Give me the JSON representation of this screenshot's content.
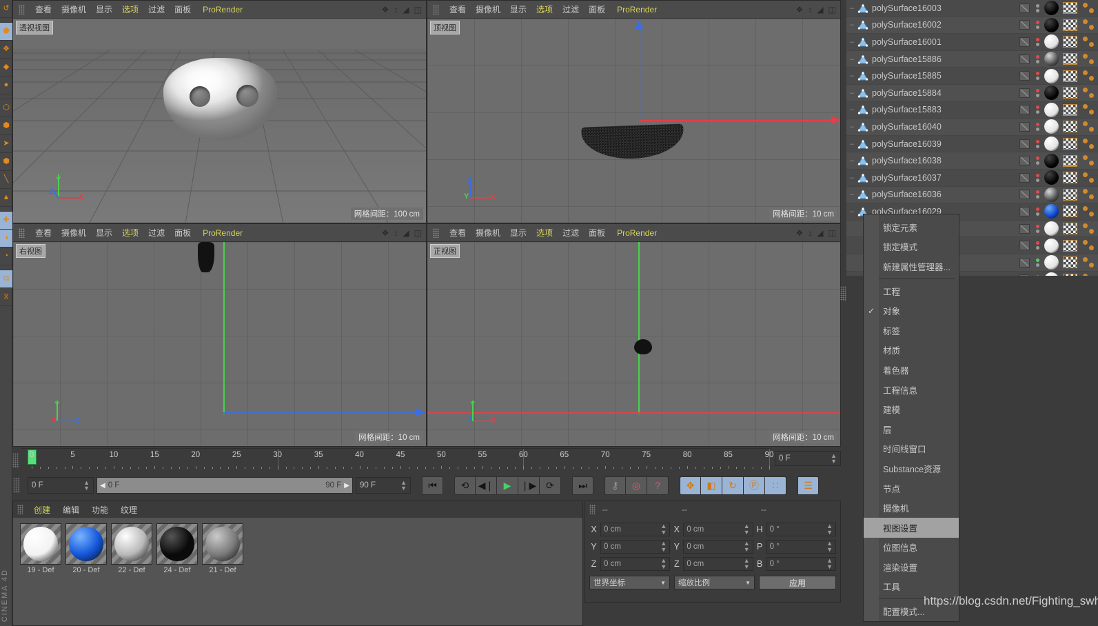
{
  "app": {
    "name": "CINEMA 4D",
    "watermark": "https://blog.csdn.net/Fighting_swh"
  },
  "left_toolbar": {
    "items": [
      {
        "name": "undo-redo-icon",
        "glyph": "↺",
        "selected": false
      },
      {
        "name": "live-selection-icon",
        "glyph": "⬟",
        "selected": true
      },
      {
        "name": "move-tool-icon",
        "glyph": "❖",
        "selected": false
      },
      {
        "name": "scale-tool-icon",
        "glyph": "◆",
        "selected": false
      },
      {
        "name": "rotate-tool-icon",
        "glyph": "●",
        "selected": false
      },
      {
        "name": "object-mode-icon",
        "glyph": "⬡",
        "selected": false
      },
      {
        "name": "model-mode-icon",
        "glyph": "⬢",
        "selected": false
      },
      {
        "name": "texture-mode-icon",
        "glyph": "➤",
        "selected": false
      },
      {
        "name": "point-mode-icon",
        "glyph": "⬢",
        "selected": false
      },
      {
        "name": "edge-mode-icon",
        "glyph": "╲",
        "selected": false
      },
      {
        "name": "polygon-mode-icon",
        "glyph": "▲",
        "selected": false
      },
      {
        "name": "axis-mode-icon",
        "glyph": "✚",
        "selected": true
      },
      {
        "name": "viewport-solo-icon",
        "glyph": "◑",
        "selected": true
      },
      {
        "name": "workplane-icon",
        "glyph": "◔",
        "selected": false
      },
      {
        "name": "snap-icon",
        "glyph": "⧉",
        "selected": true
      },
      {
        "name": "quantize-icon",
        "glyph": "⧖",
        "selected": false
      }
    ]
  },
  "viewports": [
    {
      "name": "perspective",
      "label": "透视视图",
      "grid_note": "网格间距：100 cm",
      "menu": [
        "查看",
        "摄像机",
        "显示",
        "选项",
        "过滤",
        "面板",
        "ProRender"
      ],
      "menu_highlight": [
        "选项",
        "ProRender"
      ],
      "axis_labels": [
        "Y",
        "Z",
        "X"
      ]
    },
    {
      "name": "top",
      "label": "顶视图",
      "grid_note": "网格间距：10 cm",
      "menu": [
        "查看",
        "摄像机",
        "显示",
        "选项",
        "过滤",
        "面板",
        "ProRender"
      ],
      "menu_highlight": [
        "选项",
        "ProRender"
      ],
      "axis_labels": [
        "Z",
        "Y",
        "X"
      ]
    },
    {
      "name": "right",
      "label": "右视图",
      "grid_note": "网格间距：10 cm",
      "menu": [
        "查看",
        "摄像机",
        "显示",
        "选项",
        "过滤",
        "面板",
        "ProRender"
      ],
      "menu_highlight": [
        "选项",
        "ProRender"
      ],
      "axis_labels": [
        "Y",
        "X",
        "Z"
      ]
    },
    {
      "name": "front",
      "label": "正视图",
      "grid_note": "网格间距：10 cm",
      "menu": [
        "查看",
        "摄像机",
        "显示",
        "选项",
        "过滤",
        "面板",
        "ProRender"
      ],
      "menu_highlight": [
        "选项",
        "ProRender"
      ],
      "axis_labels": [
        "Y",
        "Z",
        "X"
      ]
    }
  ],
  "timeline": {
    "ticks": [
      0,
      5,
      10,
      15,
      20,
      25,
      30,
      35,
      40,
      45,
      50,
      55,
      60,
      65,
      70,
      75,
      80,
      85,
      90
    ],
    "current_frame": "0 F",
    "playhead_frame": 0,
    "range_start": "0 F",
    "range_end": "90 F",
    "end_field": "90 F",
    "left_field": "0 F"
  },
  "transport": {
    "buttons": [
      {
        "name": "goto-start-button",
        "glyph": "⏮"
      },
      {
        "name": "previous-key-button",
        "glyph": "⟲"
      },
      {
        "name": "step-back-button",
        "glyph": "◀❘"
      },
      {
        "name": "play-button",
        "glyph": "▶"
      },
      {
        "name": "step-forward-button",
        "glyph": "❘▶"
      },
      {
        "name": "next-key-button",
        "glyph": "⟳"
      },
      {
        "name": "goto-end-button",
        "glyph": "⏭"
      },
      {
        "name": "record-settings-button",
        "glyph": "⚷"
      },
      {
        "name": "autokey-button",
        "glyph": "◎"
      },
      {
        "name": "keyframe-help-button",
        "glyph": "?"
      },
      {
        "name": "position-key-button",
        "glyph": "✥"
      },
      {
        "name": "scale-key-button",
        "glyph": "◧"
      },
      {
        "name": "rotation-key-button",
        "glyph": "↻"
      },
      {
        "name": "pla-key-button",
        "glyph": "Ⓟ"
      },
      {
        "name": "point-level-animation-button",
        "glyph": "∷"
      },
      {
        "name": "keyframe-mode-button",
        "glyph": "☰"
      }
    ]
  },
  "material_manager": {
    "menu": [
      "创建",
      "编辑",
      "功能",
      "纹理"
    ],
    "menu_highlight": [
      "创建"
    ],
    "materials": [
      {
        "name": "19 - Def",
        "color": "#f2f2f2",
        "highlight": "#ffffff"
      },
      {
        "name": "20 - Def",
        "color": "#1255d8",
        "highlight": "#79b4ff"
      },
      {
        "name": "22 - Def",
        "color": "#b8b8b8",
        "highlight": "#ffffff"
      },
      {
        "name": "24 - Def",
        "color": "#0a0a0a",
        "highlight": "#555555"
      },
      {
        "name": "21 - Def",
        "color": "#7a7a7a",
        "highlight": "#cacaca"
      }
    ]
  },
  "coordinate_manager": {
    "header": [
      "--",
      "--",
      "--"
    ],
    "rows": [
      {
        "pos_label": "X",
        "pos_value": "0 cm",
        "size_label": "X",
        "size_value": "0 cm",
        "rot_label": "H",
        "rot_value": "0 °"
      },
      {
        "pos_label": "Y",
        "pos_value": "0 cm",
        "size_label": "Y",
        "size_value": "0 cm",
        "rot_label": "P",
        "rot_value": "0 °"
      },
      {
        "pos_label": "Z",
        "pos_value": "0 cm",
        "size_label": "Z",
        "size_value": "0 cm",
        "rot_label": "B",
        "rot_value": "0 °"
      }
    ],
    "coord_system": "世界坐标",
    "scale_mode": "缩放比例",
    "apply_label": "应用"
  },
  "object_manager": {
    "objects": [
      {
        "name": "polySurface16003",
        "dot_top": "#9a9a9a",
        "dot_bottom": "#9a9a9a",
        "mat": "black",
        "partial": true
      },
      {
        "name": "polySurface16002",
        "dot_top": "#e04b4b",
        "dot_bottom": "#9a9a9a",
        "mat": "black"
      },
      {
        "name": "polySurface16001",
        "dot_top": "#e04b4b",
        "dot_bottom": "#9a9a9a",
        "mat": "white"
      },
      {
        "name": "polySurface15886",
        "dot_top": "#e04b4b",
        "dot_bottom": "#9a9a9a",
        "mat": "grey"
      },
      {
        "name": "polySurface15885",
        "dot_top": "#e04b4b",
        "dot_bottom": "#9a9a9a",
        "mat": "white"
      },
      {
        "name": "polySurface15884",
        "dot_top": "#e04b4b",
        "dot_bottom": "#9a9a9a",
        "mat": "black"
      },
      {
        "name": "polySurface15883",
        "dot_top": "#e04b4b",
        "dot_bottom": "#9a9a9a",
        "mat": "white"
      },
      {
        "name": "polySurface16040",
        "dot_top": "#e04b4b",
        "dot_bottom": "#9a9a9a",
        "mat": "white"
      },
      {
        "name": "polySurface16039",
        "dot_top": "#e04b4b",
        "dot_bottom": "#9a9a9a",
        "mat": "white"
      },
      {
        "name": "polySurface16038",
        "dot_top": "#e04b4b",
        "dot_bottom": "#9a9a9a",
        "mat": "black"
      },
      {
        "name": "polySurface16037",
        "dot_top": "#e04b4b",
        "dot_bottom": "#9a9a9a",
        "mat": "black"
      },
      {
        "name": "polySurface16036",
        "dot_top": "#e04b4b",
        "dot_bottom": "#9a9a9a",
        "mat": "grey"
      },
      {
        "name": "polySurface16029",
        "dot_top": "#e04b4b",
        "dot_bottom": "#9a9a9a",
        "mat": "blue"
      },
      {
        "name": "",
        "dot_top": "#e04b4b",
        "dot_bottom": "#9a9a9a",
        "mat": "white"
      },
      {
        "name": "",
        "dot_top": "#e04b4b",
        "dot_bottom": "#9a9a9a",
        "mat": "white"
      },
      {
        "name": "",
        "dot_top": "#4fd06a",
        "dot_bottom": "#9a9a9a",
        "mat": "white"
      },
      {
        "name": "",
        "dot_top": "#e04b4b",
        "dot_bottom": "#9a9a9a",
        "mat": "white"
      }
    ]
  },
  "context_menu": {
    "group1": [
      "锁定元素",
      "锁定模式",
      "新建属性管理器..."
    ],
    "group2": [
      {
        "label": "工程",
        "checked": false
      },
      {
        "label": "对象",
        "checked": true
      },
      {
        "label": "标签",
        "checked": false
      },
      {
        "label": "材质",
        "checked": false
      },
      {
        "label": "着色器",
        "checked": false
      },
      {
        "label": "工程信息",
        "checked": false
      },
      {
        "label": "建模",
        "checked": false
      },
      {
        "label": "层",
        "checked": false
      },
      {
        "label": "时间线窗口",
        "checked": false
      },
      {
        "label": "Substance资源",
        "checked": false
      },
      {
        "label": "节点",
        "checked": false
      },
      {
        "label": "摄像机",
        "checked": false
      },
      {
        "label": "视图设置",
        "checked": false,
        "selected": true
      },
      {
        "label": "位图信息",
        "checked": false
      },
      {
        "label": "渲染设置",
        "checked": false
      },
      {
        "label": "工具",
        "checked": false
      }
    ],
    "group3": [
      "配置模式..."
    ]
  }
}
